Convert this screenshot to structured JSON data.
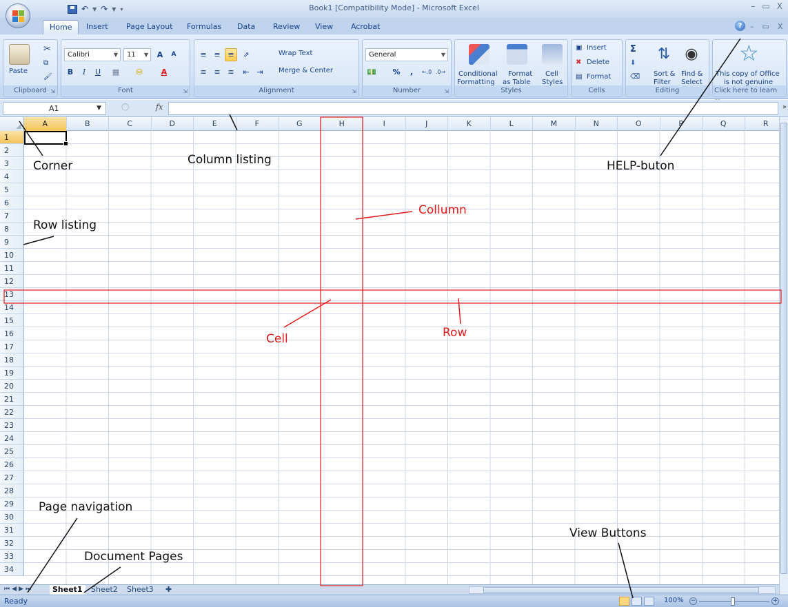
{
  "window": {
    "title": "Book1  [Compatibility Mode] - Microsoft Excel",
    "controls": [
      "–",
      "▭",
      "X"
    ]
  },
  "ribbon_tabs": [
    "Home",
    "Insert",
    "Page Layout",
    "Formulas",
    "Data",
    "Review",
    "View",
    "Acrobat"
  ],
  "ribbon_controls": [
    "–",
    "▭",
    "X"
  ],
  "clipboard": {
    "paste": "Paste",
    "group": "Clipboard"
  },
  "font": {
    "name": "Calibri",
    "size": "11",
    "bold": "B",
    "italic": "I",
    "underline": "U",
    "grow": "A",
    "shrink": "A",
    "color": "A",
    "group": "Font"
  },
  "alignment": {
    "wrap": "Wrap Text",
    "merge": "Merge & Center",
    "group": "Alignment"
  },
  "number": {
    "format": "General",
    "percent": "%",
    "comma": ",",
    "group": "Number"
  },
  "styles": {
    "conditional": [
      "Conditional",
      "Formatting"
    ],
    "table": [
      "Format",
      "as Table"
    ],
    "cell": [
      "Cell",
      "Styles"
    ],
    "group": "Styles"
  },
  "cells": {
    "insert": "Insert",
    "delete": "Delete",
    "format": "Format",
    "group": "Cells"
  },
  "editing": {
    "sigma": "Σ",
    "sort": [
      "Sort &",
      "Filter"
    ],
    "find": [
      "Find &",
      "Select"
    ],
    "group": "Editing"
  },
  "genuine": {
    "line1": "This copy of Office",
    "line2": "is not genuine",
    "link": "Click here to learn m..."
  },
  "formula_bar": {
    "name_box": "A1",
    "fx": "fx",
    "value": ""
  },
  "columns": [
    "A",
    "B",
    "C",
    "D",
    "E",
    "F",
    "G",
    "H",
    "I",
    "J",
    "K",
    "L",
    "M",
    "N",
    "O",
    "P",
    "Q",
    "R"
  ],
  "rows": [
    "1",
    "2",
    "3",
    "4",
    "5",
    "6",
    "7",
    "8",
    "9",
    "10",
    "11",
    "12",
    "13",
    "14",
    "15",
    "16",
    "17",
    "18",
    "19",
    "20",
    "21",
    "22",
    "23",
    "24",
    "25",
    "26",
    "27",
    "28",
    "29",
    "30",
    "31",
    "32",
    "33",
    "34"
  ],
  "sheets": [
    "Sheet1",
    "Sheet2",
    "Sheet3"
  ],
  "status": {
    "text": "Ready",
    "zoom": "100%"
  },
  "annotations": {
    "corner": "Corner",
    "column_listing": "Column listing",
    "help": "HELP-buton",
    "row_listing": "Row listing",
    "collumn": "Collumn",
    "cell": "Cell",
    "row": "Row",
    "page_navigation": "Page navigation",
    "document_pages": "Document Pages",
    "view_buttons": "View Buttons"
  },
  "colors": {
    "annotation_black": "#111111",
    "annotation_red": "#e21b1b",
    "ribbon": "#d2e2f6",
    "selected_header": "#f4c35a"
  }
}
